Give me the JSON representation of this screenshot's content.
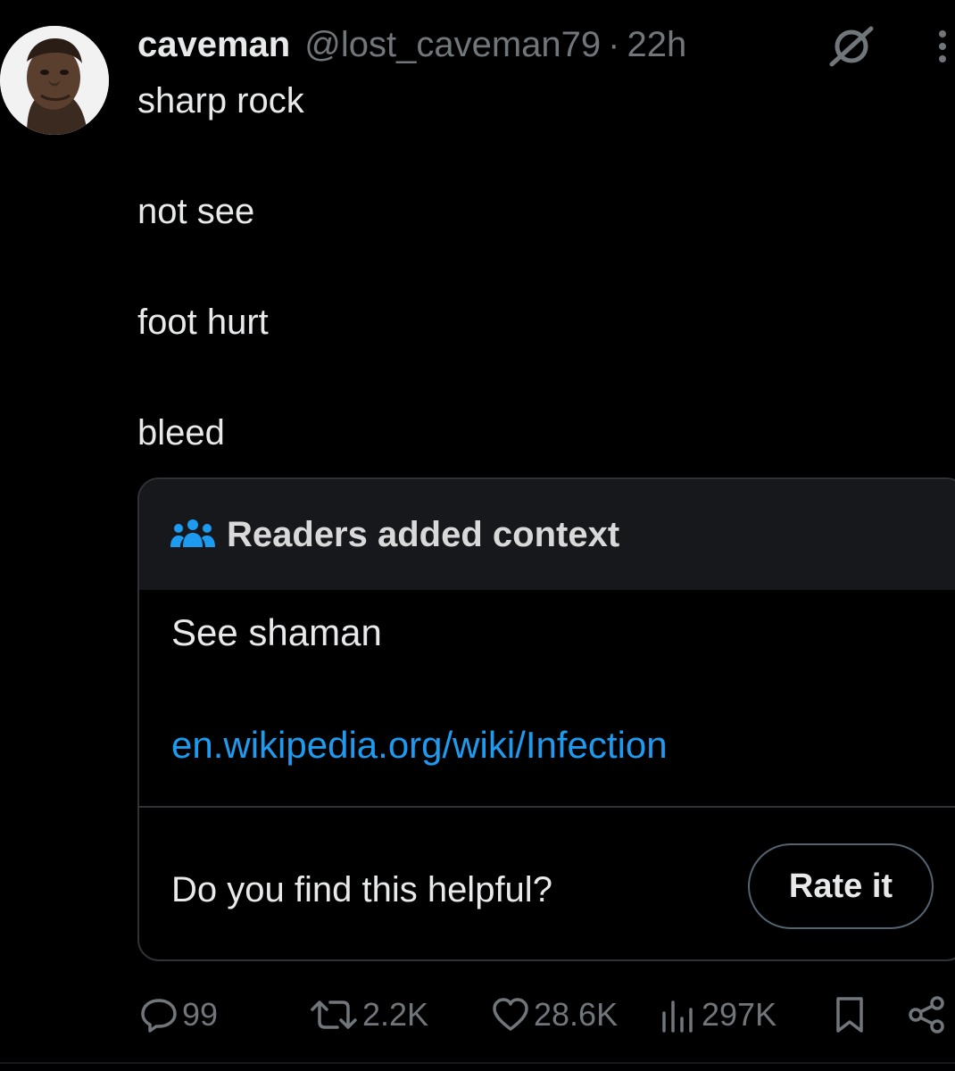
{
  "post": {
    "display_name": "caveman",
    "handle": "@lost_caveman79",
    "separator": "·",
    "time": "22h",
    "text_lines": [
      "sharp rock",
      "not see",
      "foot hurt",
      "bleed"
    ]
  },
  "community_note": {
    "title": "Readers added context",
    "body": "See shaman",
    "link": "en.wikipedia.org/wiki/Infection",
    "helpful_prompt": "Do you find this helpful?",
    "rate_label": "Rate it"
  },
  "actions": {
    "replies": "99",
    "reposts": "2.2K",
    "likes": "28.6K",
    "views": "297K"
  },
  "icons": {
    "grok": "grok-icon",
    "more": "more-vertical-icon",
    "note": "people-group-icon",
    "reply": "reply-icon",
    "repost": "repost-icon",
    "like": "heart-icon",
    "views": "views-bar-icon",
    "bookmark": "bookmark-icon",
    "share": "share-icon"
  },
  "colors": {
    "background": "#000000",
    "text": "#e7e9ea",
    "secondary": "#71767b",
    "link": "#1d9bf0",
    "note_header_bg": "#16181c",
    "border": "#2f3336"
  }
}
